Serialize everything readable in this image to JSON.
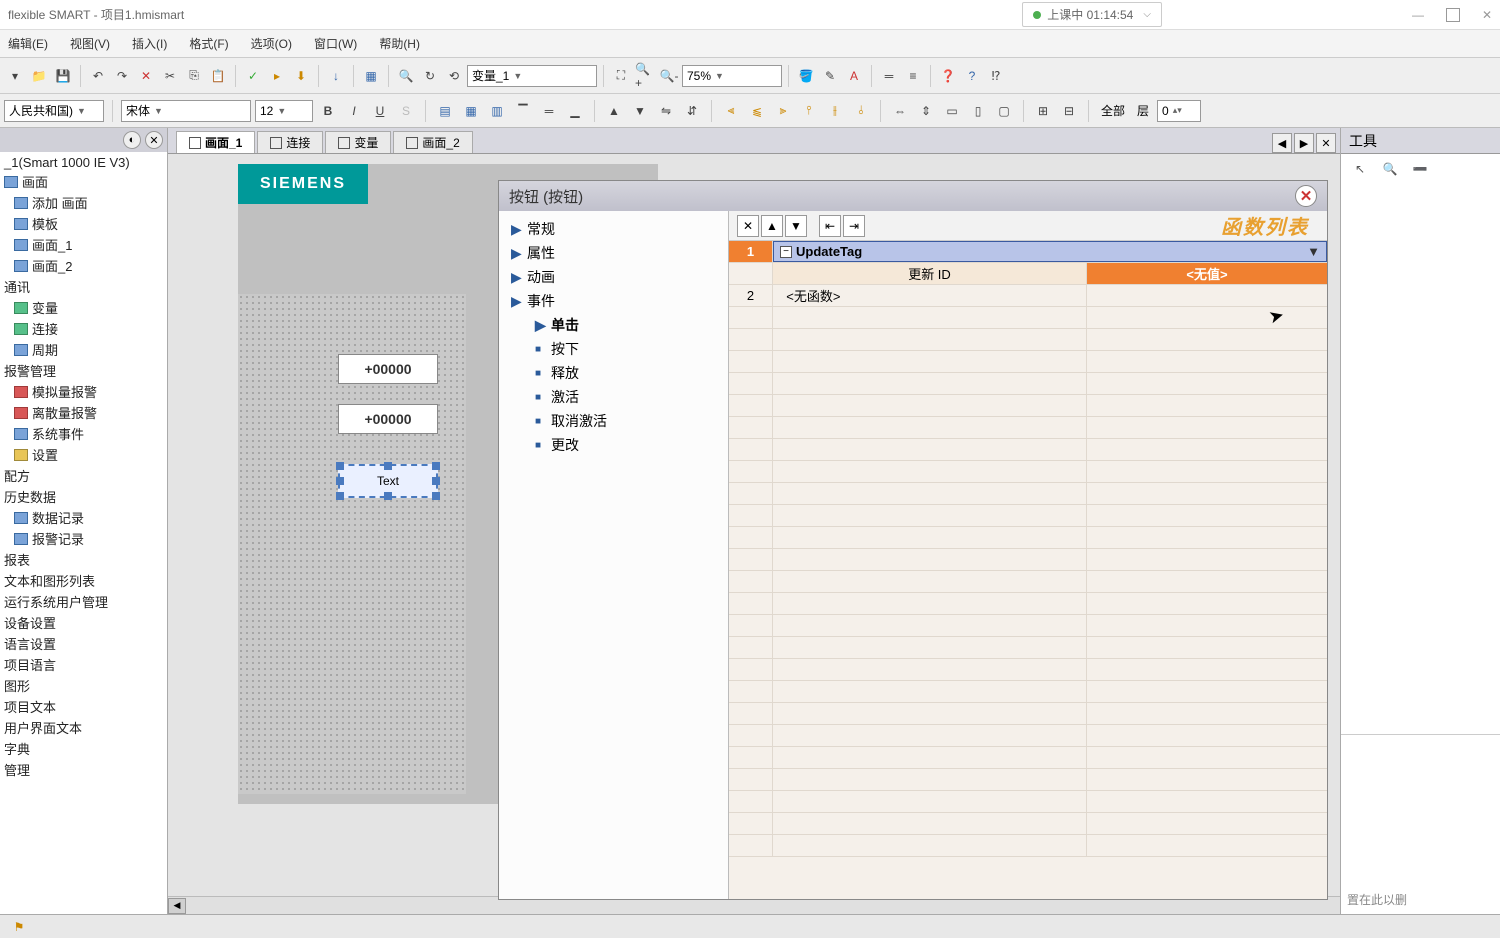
{
  "title": "flexible SMART - 项目1.hmismart",
  "status": {
    "label": "上课中 01:14:54"
  },
  "menu": {
    "edit": "编辑(E)",
    "view": "视图(V)",
    "insert": "插入(I)",
    "format": "格式(F)",
    "options": "选项(O)",
    "window": "窗口(W)",
    "help": "帮助(H)"
  },
  "toolbar": {
    "combo1": "变量_1",
    "zoom": "75%",
    "lang": "人民共和国)",
    "font": "宋体",
    "size": "12",
    "all": "全部",
    "layer": "层",
    "layerNum": "0"
  },
  "tree": {
    "root": "_1(Smart 1000 IE V3)",
    "items": [
      "画面",
      "添加 画面",
      "模板",
      "画面_1",
      "画面_2",
      "通讯",
      "变量",
      "连接",
      "周期",
      "报警管理",
      "模拟量报警",
      "离散量报警",
      "系统事件",
      "设置",
      "配方",
      "历史数据",
      "数据记录",
      "报警记录",
      "报表",
      "文本和图形列表",
      "运行系统用户管理",
      "设备设置",
      "语言设置",
      "项目语言",
      "图形",
      "项目文本",
      "用户界面文本",
      "字典",
      "管理"
    ]
  },
  "tabs": {
    "t1": "画面_1",
    "t2": "连接",
    "t3": "变量",
    "t4": "画面_2"
  },
  "canvas": {
    "siemens": "SIEMENS",
    "io1": "+00000",
    "io2": "+00000",
    "btn": "Text"
  },
  "prop": {
    "title": "按钮 (按钮)",
    "cats": {
      "general": "常规",
      "props": "属性",
      "anim": "动画",
      "events": "事件",
      "click": "单击",
      "press": "按下",
      "release": "释放",
      "activate": "激活",
      "deactivate": "取消激活",
      "change": "更改"
    },
    "funcTitle": "函数列表",
    "row1": {
      "num": "1",
      "func": "UpdateTag"
    },
    "row1b": {
      "param": "更新 ID",
      "val": "<无值>"
    },
    "row2": {
      "num": "2",
      "func": "<无函数>"
    }
  },
  "right": {
    "title": "工具",
    "hint": "置在此以删"
  }
}
